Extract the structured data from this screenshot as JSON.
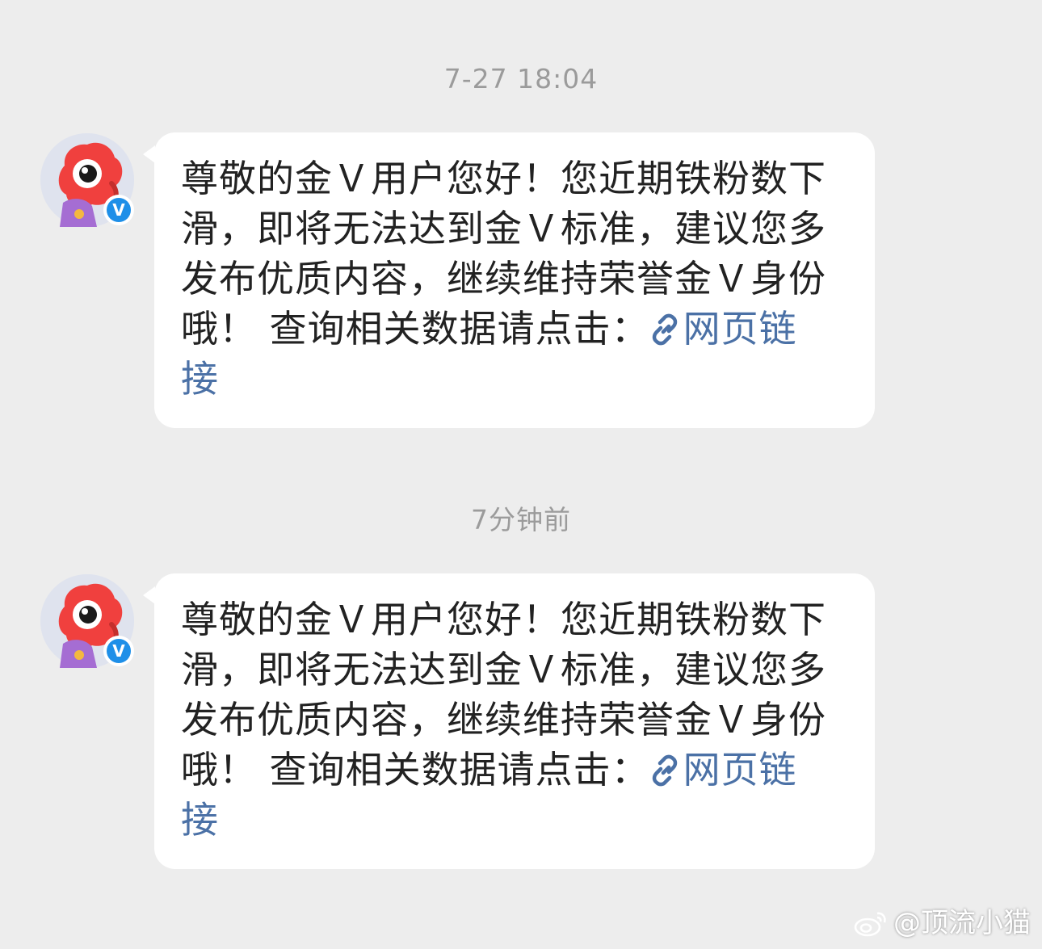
{
  "colors": {
    "background": "#ededed",
    "bubble": "#ffffff",
    "timestamp": "#9b9b9b",
    "message_text": "#222222",
    "link": "#4b71a6",
    "verified_badge": "#1e8fe8",
    "mascot_red": "#f0403e"
  },
  "messages": [
    {
      "timestamp": "7-27 18:04",
      "sender_avatar_icon": "weibo-mascot-icon",
      "verified_badge": "V",
      "text": "尊敬的金Ｖ用户您好！您近期铁粉数下滑，即将无法达到金Ｖ标准，建议您多发布优质内容，继续维持荣誉金Ｖ身份哦！ 查询相关数据请点击：",
      "link_icon": "link-icon",
      "link_text": "网页链接"
    },
    {
      "timestamp": "7分钟前",
      "sender_avatar_icon": "weibo-mascot-icon",
      "verified_badge": "V",
      "text": "尊敬的金Ｖ用户您好！您近期铁粉数下滑，即将无法达到金Ｖ标准，建议您多发布优质内容，继续维持荣誉金Ｖ身份哦！ 查询相关数据请点击：",
      "link_icon": "link-icon",
      "link_text": "网页链接"
    }
  ],
  "watermark": {
    "icon": "weibo-logo-icon",
    "text": "@顶流小猫"
  }
}
